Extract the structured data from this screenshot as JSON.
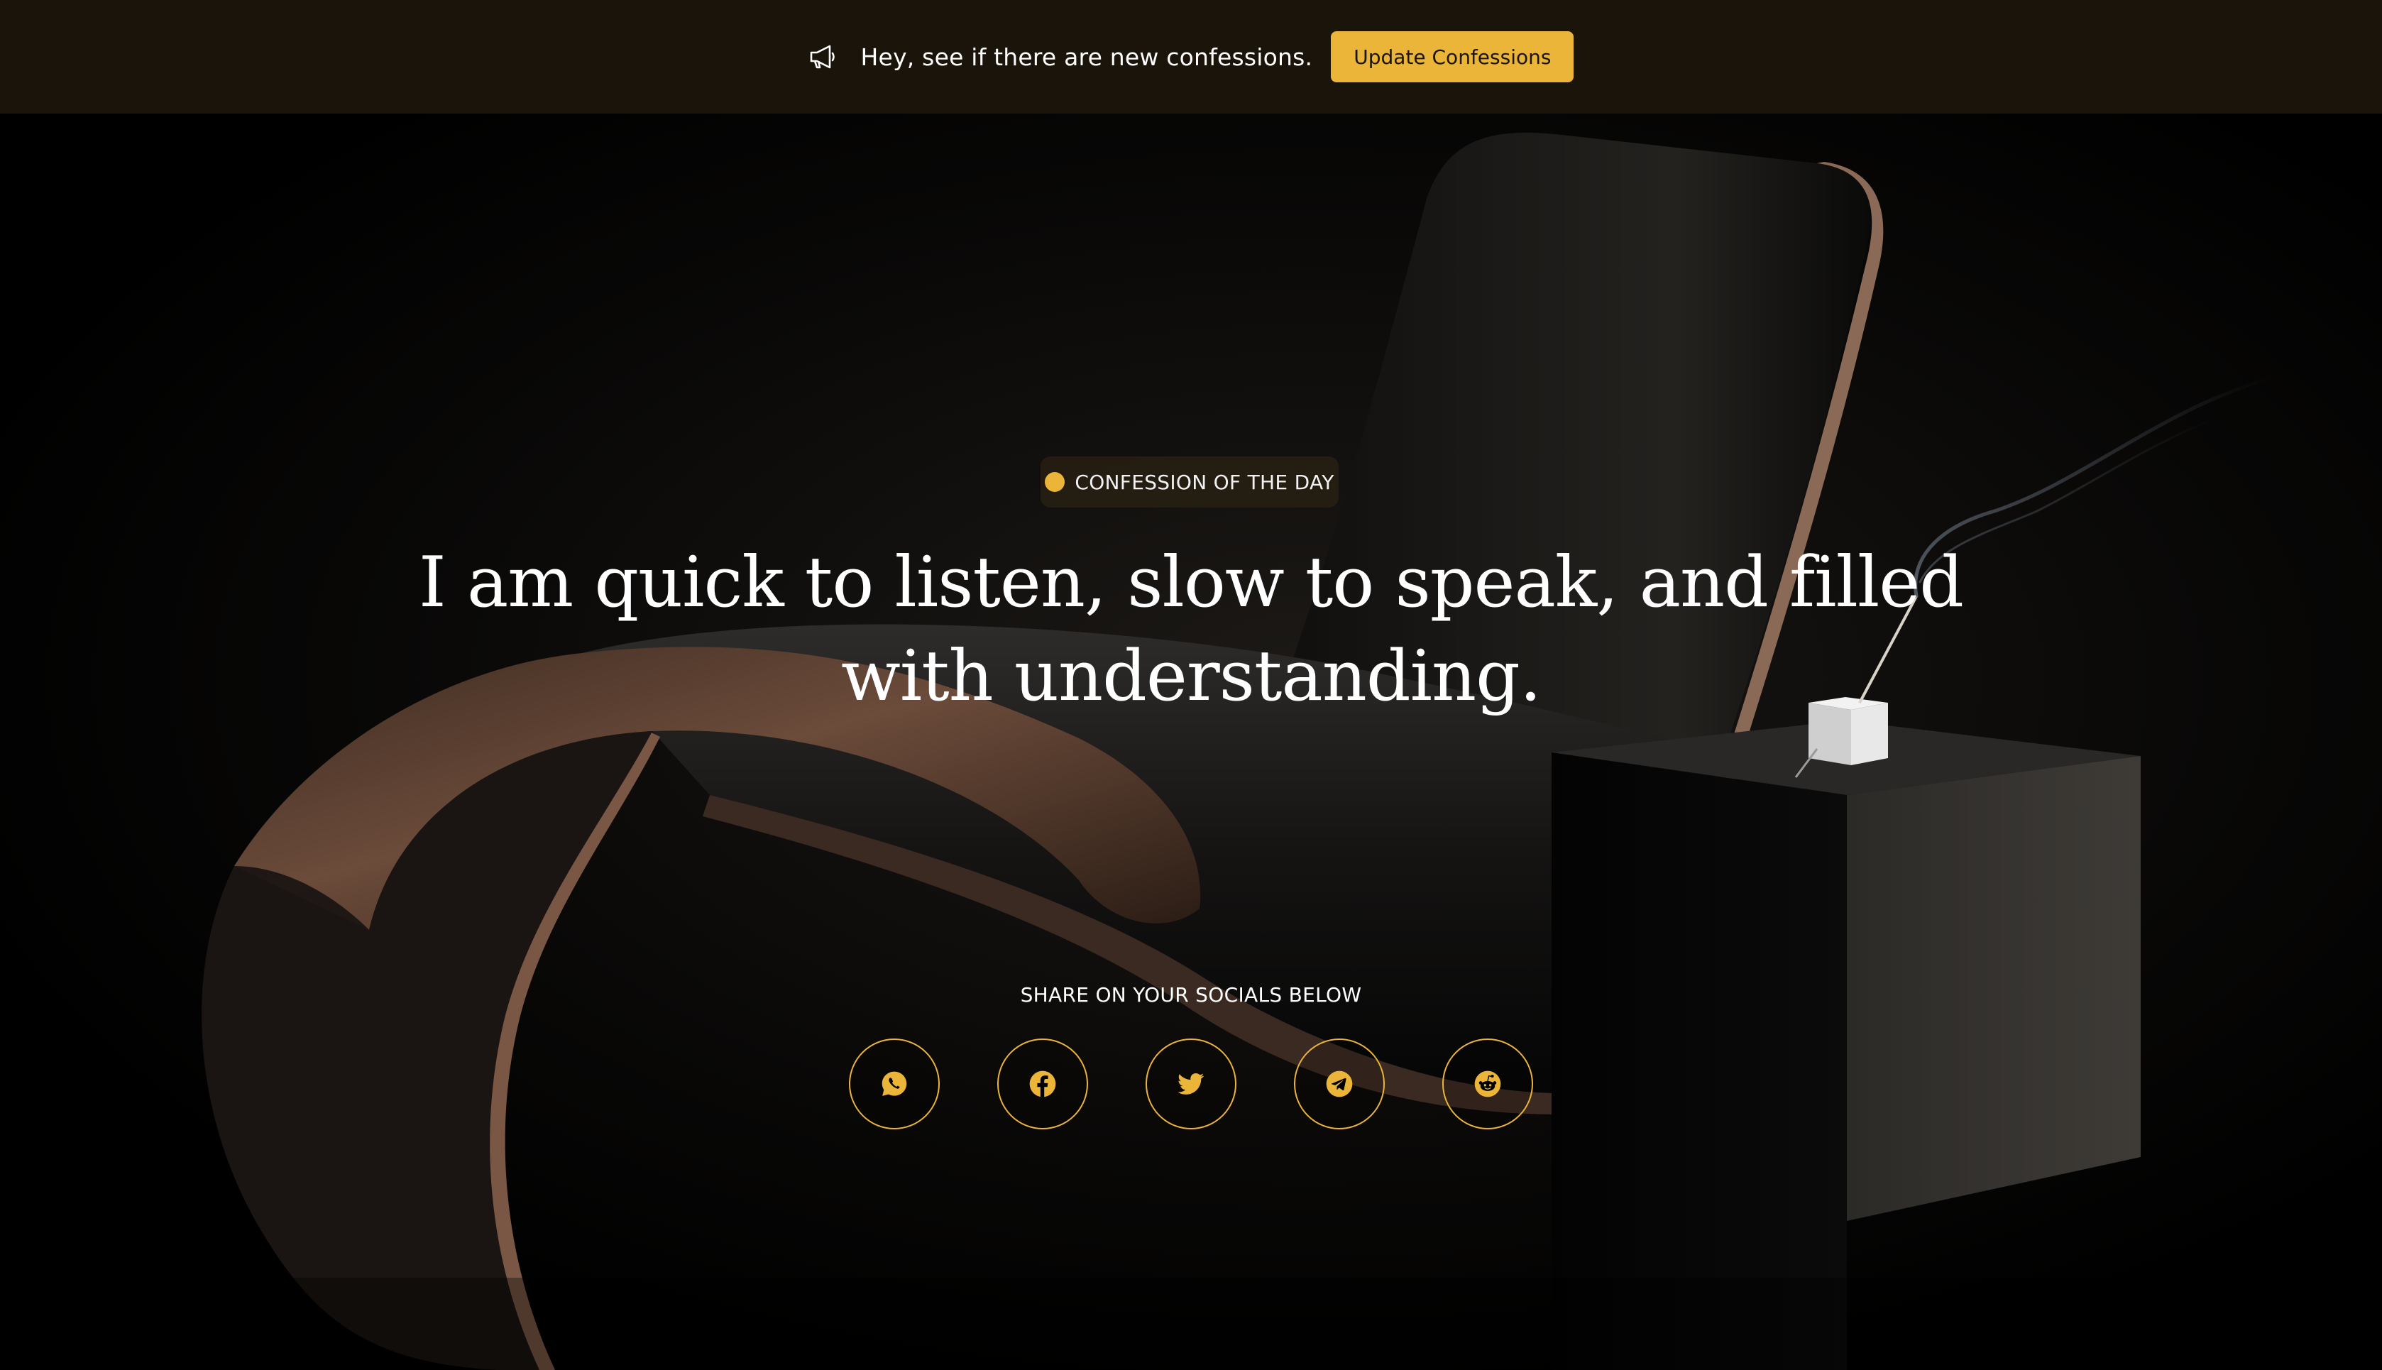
{
  "banner": {
    "message": "Hey, see if there are new confessions.",
    "button_label": "Update Confessions",
    "icon": "megaphone-icon"
  },
  "hero": {
    "badge_label": "CONFESSION OF THE DAY",
    "confession": "I am quick to listen, slow to speak, and filled with understanding.",
    "share_label": "SHARE ON YOUR SOCIALS BELOW"
  },
  "socials": [
    {
      "icon": "whatsapp-icon"
    },
    {
      "icon": "facebook-icon"
    },
    {
      "icon": "twitter-icon"
    },
    {
      "icon": "telegram-icon"
    },
    {
      "icon": "reddit-icon"
    }
  ],
  "colors": {
    "accent": "#eab538",
    "banner_background": "#1a140a",
    "page_background": "#000000",
    "text": "#ffffff"
  }
}
